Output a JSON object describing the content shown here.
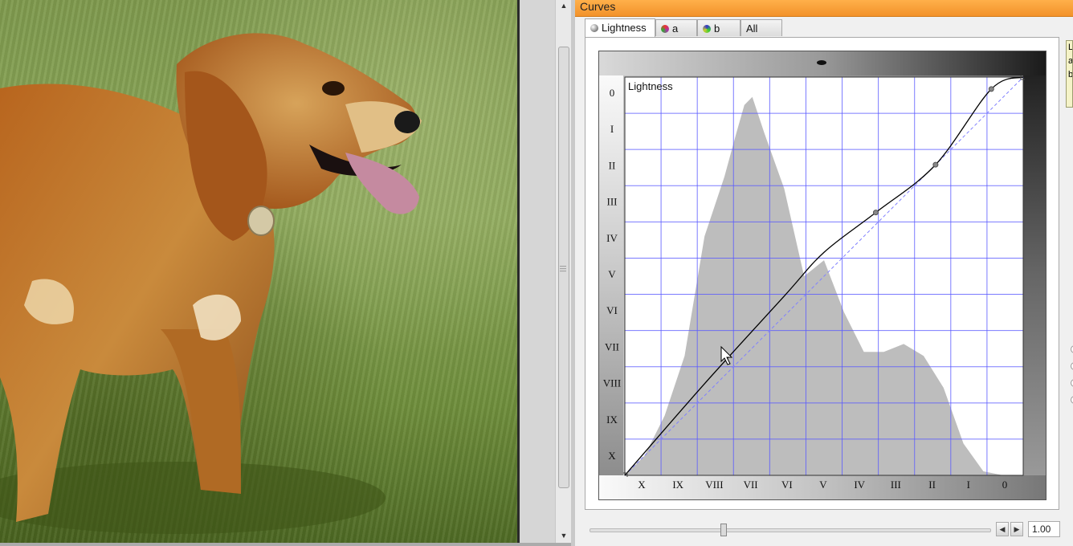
{
  "panel": {
    "title": "Curves",
    "tabs": [
      {
        "label": "Lightness",
        "icon": "lightness-channel-icon",
        "active": true
      },
      {
        "label": "a",
        "icon": "a-channel-icon",
        "active": false
      },
      {
        "label": "b",
        "icon": "b-channel-icon",
        "active": false
      },
      {
        "label": "All",
        "icon": "",
        "active": false
      }
    ],
    "chart_label": "Lightness",
    "y_labels": [
      "0",
      "I",
      "II",
      "III",
      "IV",
      "V",
      "VI",
      "VII",
      "VIII",
      "IX",
      "X"
    ],
    "x_labels": [
      "X",
      "IX",
      "VIII",
      "VII",
      "VI",
      "V",
      "IV",
      "III",
      "II",
      "I",
      "0"
    ],
    "side_info": [
      "L",
      "a",
      "b"
    ],
    "slider_value": "1.00"
  },
  "colors": {
    "title_bar": "#f2922a",
    "grid": "#5a5aff",
    "histogram": "#bdbdbd",
    "curve": "#000000"
  },
  "chart_data": {
    "type": "area",
    "title": "",
    "xlabel": "",
    "ylabel": "",
    "x_tick_labels": [
      "X",
      "IX",
      "VIII",
      "VII",
      "VI",
      "V",
      "IV",
      "III",
      "II",
      "I",
      "0"
    ],
    "y_tick_labels": [
      "0",
      "I",
      "II",
      "III",
      "IV",
      "V",
      "VI",
      "VII",
      "VIII",
      "IX",
      "X"
    ],
    "xlim": [
      0,
      10
    ],
    "ylim": [
      0,
      10
    ],
    "grid": true,
    "series": [
      {
        "name": "Histogram",
        "x": [
          0,
          0.5,
          1,
          1.5,
          2,
          2.5,
          2.8,
          3,
          3.2,
          3.5,
          4,
          4.5,
          5,
          5.5,
          6,
          6.5,
          7,
          7.5,
          8,
          8.5,
          9,
          9.5,
          10
        ],
        "values": [
          0,
          0.5,
          1.5,
          3,
          6,
          7.5,
          8.6,
          9.3,
          9.5,
          8.6,
          7.2,
          5,
          5.4,
          4.1,
          3.1,
          3.1,
          3.3,
          3,
          2.2,
          0.8,
          0.1,
          0,
          0
        ]
      },
      {
        "name": "Curve",
        "x": [
          0,
          2,
          4,
          5,
          6.3,
          7.8,
          9.2,
          10
        ],
        "values": [
          0,
          2.3,
          4.5,
          5.6,
          6.6,
          7.8,
          9.7,
          10
        ]
      },
      {
        "name": "Identity",
        "x": [
          0,
          10
        ],
        "values": [
          0,
          10
        ]
      }
    ],
    "control_points": [
      [
        6.3,
        6.6
      ],
      [
        7.8,
        7.8
      ],
      [
        9.2,
        9.7
      ]
    ]
  }
}
